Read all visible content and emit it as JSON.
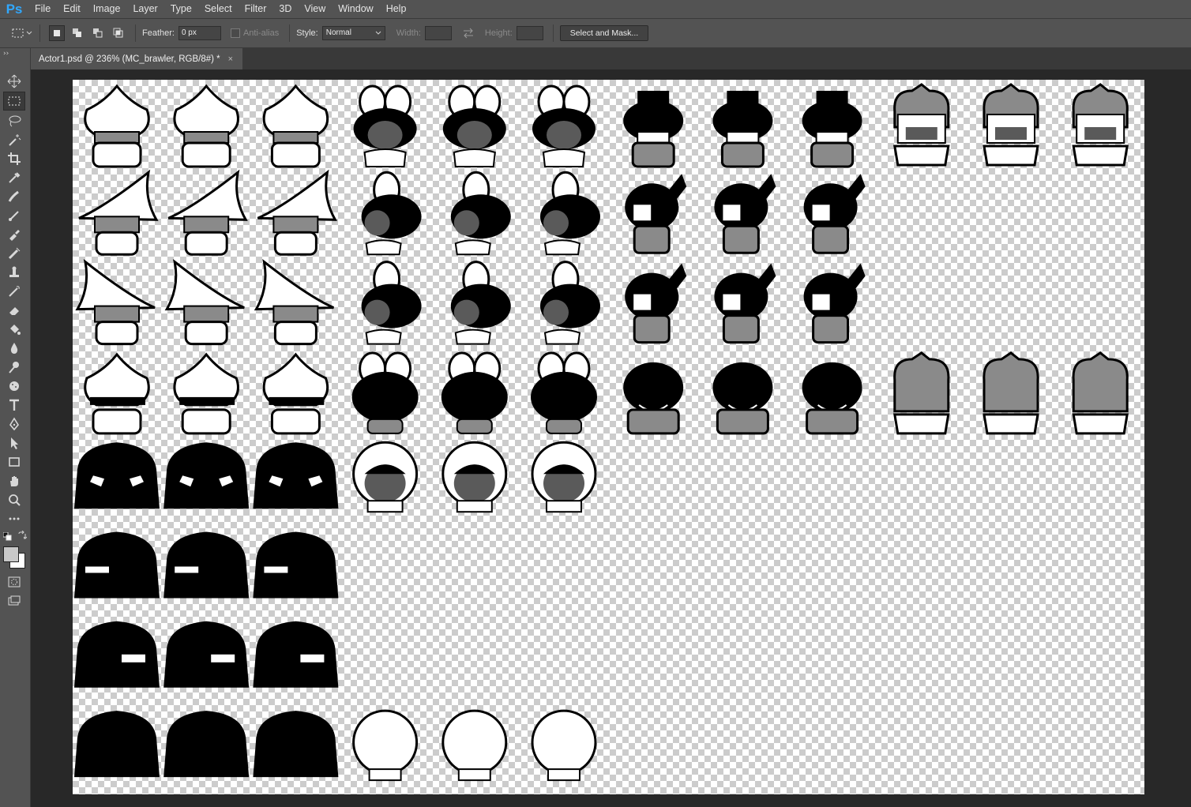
{
  "app": {
    "logo": "Ps"
  },
  "menu": [
    "File",
    "Edit",
    "Image",
    "Layer",
    "Type",
    "Select",
    "Filter",
    "3D",
    "View",
    "Window",
    "Help"
  ],
  "options": {
    "feather_label": "Feather:",
    "feather_value": "0 px",
    "antialias_label": "Anti-alias",
    "style_label": "Style:",
    "style_value": "Normal",
    "width_label": "Width:",
    "height_label": "Height:",
    "select_mask_label": "Select and Mask..."
  },
  "document": {
    "tab_title": "Actor1.psd @ 236% (MC_brawler, RGB/8#) *",
    "close_symbol": "×"
  },
  "tools": [
    "move-icon",
    "rect-marquee-icon",
    "lasso-icon",
    "magic-wand-icon",
    "crop-icon",
    "eyedropper-icon",
    "healing-brush-icon",
    "brush-icon",
    "clone-stamp-icon",
    "history-brush-icon",
    "eraser-icon",
    "paint-bucket-icon",
    "blur-icon",
    "dodge-icon",
    "pen-icon",
    "type-icon",
    "path-selection-icon",
    "rectangle-shape-icon",
    "hand-icon",
    "zoom-icon",
    "more-tools-icon",
    "swap-colors-icon",
    "color-swatches",
    "quick-mask-icon",
    "screen-mode-icon"
  ],
  "colors": {
    "foreground": "#c8c8c8",
    "background": "#ffffff",
    "accent": "#31a8ff"
  },
  "sprites": [
    {
      "row": 0,
      "col": 0,
      "kind": "onion"
    },
    {
      "row": 0,
      "col": 1,
      "kind": "onion"
    },
    {
      "row": 0,
      "col": 2,
      "kind": "onion"
    },
    {
      "row": 0,
      "col": 3,
      "kind": "bow-girl"
    },
    {
      "row": 0,
      "col": 4,
      "kind": "bow-girl"
    },
    {
      "row": 0,
      "col": 5,
      "kind": "bow-girl"
    },
    {
      "row": 0,
      "col": 6,
      "kind": "dark-hair"
    },
    {
      "row": 0,
      "col": 7,
      "kind": "dark-hair"
    },
    {
      "row": 0,
      "col": 8,
      "kind": "dark-hair"
    },
    {
      "row": 0,
      "col": 9,
      "kind": "gray-hair"
    },
    {
      "row": 0,
      "col": 10,
      "kind": "gray-hair"
    },
    {
      "row": 0,
      "col": 11,
      "kind": "gray-hair"
    },
    {
      "row": 1,
      "col": 0,
      "kind": "witch-hat-left"
    },
    {
      "row": 1,
      "col": 1,
      "kind": "witch-hat-left"
    },
    {
      "row": 1,
      "col": 2,
      "kind": "witch-hat-left"
    },
    {
      "row": 1,
      "col": 3,
      "kind": "bow-girl-side"
    },
    {
      "row": 1,
      "col": 4,
      "kind": "bow-girl-side"
    },
    {
      "row": 1,
      "col": 5,
      "kind": "bow-girl-side"
    },
    {
      "row": 1,
      "col": 6,
      "kind": "ponytail-side"
    },
    {
      "row": 1,
      "col": 7,
      "kind": "ponytail-side"
    },
    {
      "row": 1,
      "col": 8,
      "kind": "ponytail-side"
    },
    {
      "row": 2,
      "col": 0,
      "kind": "witch-hat-right"
    },
    {
      "row": 2,
      "col": 1,
      "kind": "witch-hat-right"
    },
    {
      "row": 2,
      "col": 2,
      "kind": "witch-hat-right"
    },
    {
      "row": 2,
      "col": 3,
      "kind": "bow-girl-side"
    },
    {
      "row": 2,
      "col": 4,
      "kind": "bow-girl-side"
    },
    {
      "row": 2,
      "col": 5,
      "kind": "bow-girl-side"
    },
    {
      "row": 2,
      "col": 6,
      "kind": "ponytail-side"
    },
    {
      "row": 2,
      "col": 7,
      "kind": "ponytail-side"
    },
    {
      "row": 2,
      "col": 8,
      "kind": "ponytail-side"
    },
    {
      "row": 3,
      "col": 0,
      "kind": "onion-back"
    },
    {
      "row": 3,
      "col": 1,
      "kind": "onion-back"
    },
    {
      "row": 3,
      "col": 2,
      "kind": "onion-back"
    },
    {
      "row": 3,
      "col": 3,
      "kind": "bow-girl-back"
    },
    {
      "row": 3,
      "col": 4,
      "kind": "bow-girl-back"
    },
    {
      "row": 3,
      "col": 5,
      "kind": "bow-girl-back"
    },
    {
      "row": 3,
      "col": 6,
      "kind": "dark-hair-back"
    },
    {
      "row": 3,
      "col": 7,
      "kind": "dark-hair-back"
    },
    {
      "row": 3,
      "col": 8,
      "kind": "dark-hair-back"
    },
    {
      "row": 3,
      "col": 9,
      "kind": "gray-hair-back"
    },
    {
      "row": 3,
      "col": 10,
      "kind": "gray-hair-back"
    },
    {
      "row": 3,
      "col": 11,
      "kind": "gray-hair-back"
    },
    {
      "row": 4,
      "col": 0,
      "kind": "shadow-blob-eyes"
    },
    {
      "row": 4,
      "col": 1,
      "kind": "shadow-blob-eyes"
    },
    {
      "row": 4,
      "col": 2,
      "kind": "shadow-blob-eyes"
    },
    {
      "row": 4,
      "col": 3,
      "kind": "bubble-kid"
    },
    {
      "row": 4,
      "col": 4,
      "kind": "bubble-kid"
    },
    {
      "row": 4,
      "col": 5,
      "kind": "bubble-kid"
    },
    {
      "row": 5,
      "col": 0,
      "kind": "shadow-blob-left"
    },
    {
      "row": 5,
      "col": 1,
      "kind": "shadow-blob-left"
    },
    {
      "row": 5,
      "col": 2,
      "kind": "shadow-blob-left"
    },
    {
      "row": 6,
      "col": 0,
      "kind": "shadow-blob-right"
    },
    {
      "row": 6,
      "col": 1,
      "kind": "shadow-blob-right"
    },
    {
      "row": 6,
      "col": 2,
      "kind": "shadow-blob-right"
    },
    {
      "row": 7,
      "col": 0,
      "kind": "shadow-blob-back"
    },
    {
      "row": 7,
      "col": 1,
      "kind": "shadow-blob-back"
    },
    {
      "row": 7,
      "col": 2,
      "kind": "shadow-blob-back"
    },
    {
      "row": 7,
      "col": 3,
      "kind": "bubble-back"
    },
    {
      "row": 7,
      "col": 4,
      "kind": "bubble-back"
    },
    {
      "row": 7,
      "col": 5,
      "kind": "bubble-back"
    }
  ]
}
